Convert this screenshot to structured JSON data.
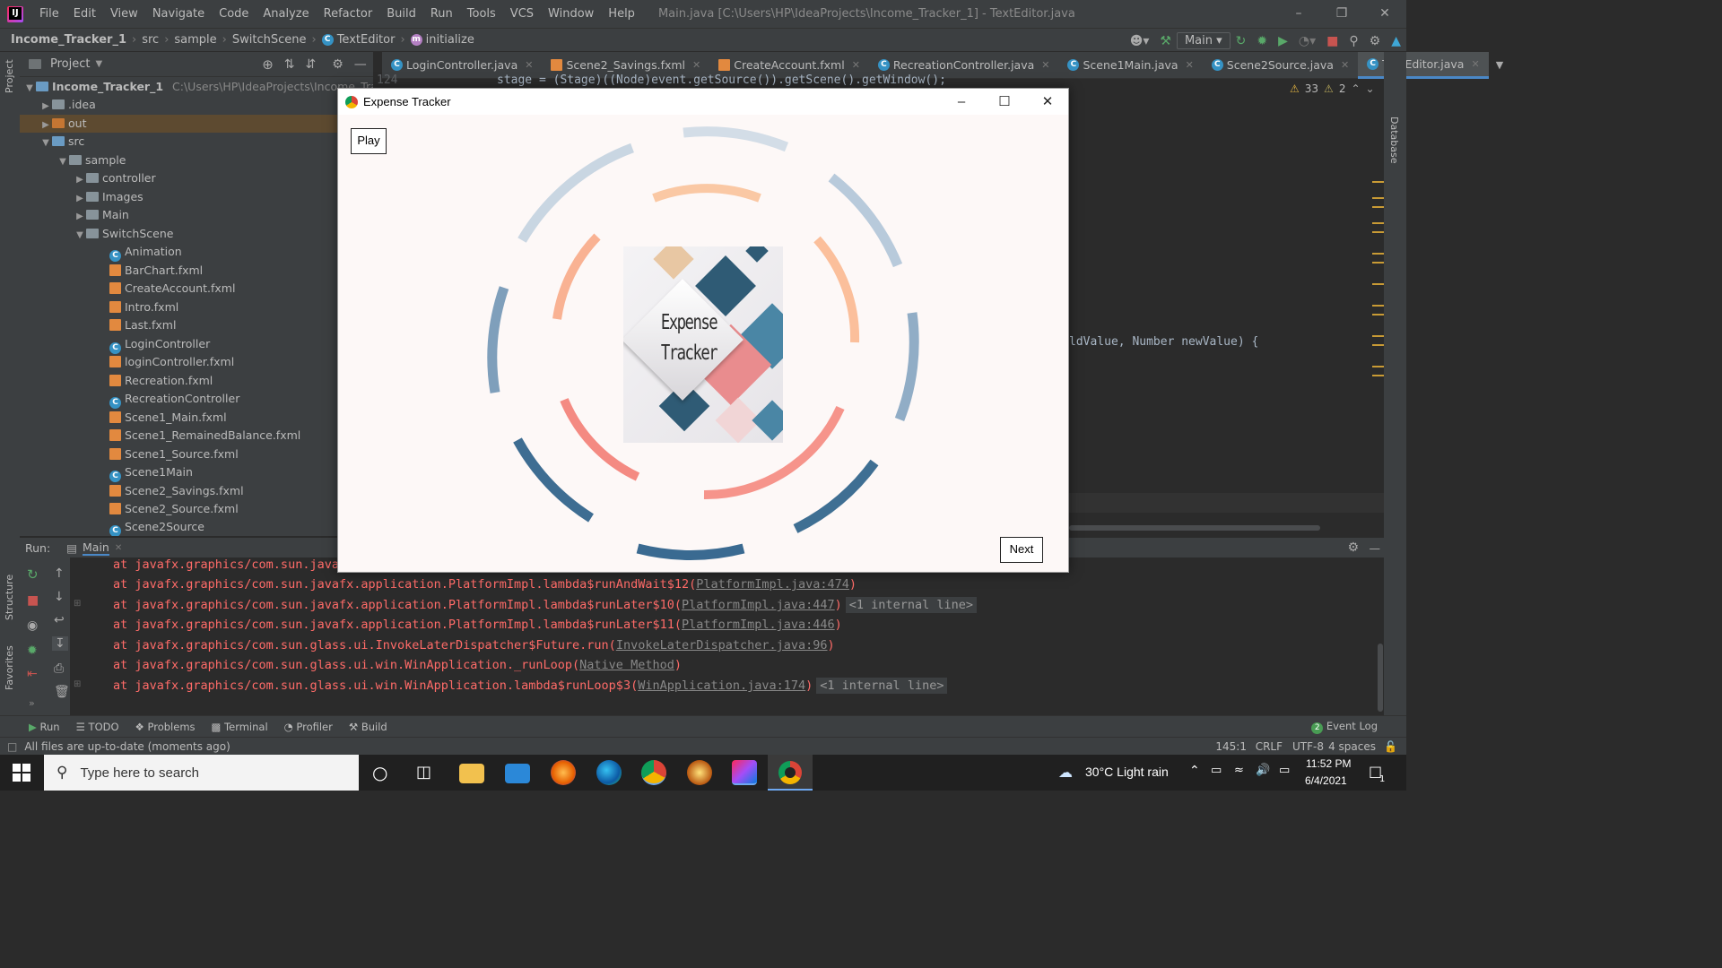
{
  "ide": {
    "menu": [
      "File",
      "Edit",
      "View",
      "Navigate",
      "Code",
      "Analyze",
      "Refactor",
      "Build",
      "Run",
      "Tools",
      "VCS",
      "Window",
      "Help"
    ],
    "window_title": "Main.java [C:\\Users\\HP\\IdeaProjects\\Income_Tracker_1] - TextEditor.java",
    "breadcrumb": {
      "project": "Income_Tracker_1",
      "src": "src",
      "sample": "sample",
      "switchscene": "SwitchScene",
      "class": "TextEditor",
      "method": "initialize"
    },
    "run_config": "Main",
    "project_panel": {
      "title": "Project",
      "root_name": "Income_Tracker_1",
      "root_path": "C:\\Users\\HP\\IdeaProjects\\Income_Tracker_1",
      "items": [
        ".idea",
        "out",
        "src",
        "sample",
        "controller",
        "Images",
        "Main",
        "SwitchScene",
        "Animation",
        "BarChart.fxml",
        "CreateAccount.fxml",
        "Intro.fxml",
        "Last.fxml",
        "LoginController",
        "loginController.fxml",
        "Recreation.fxml",
        "RecreationController",
        "Scene1_Main.fxml",
        "Scene1_RemainedBalance.fxml",
        "Scene1_Source.fxml",
        "Scene1Main",
        "Scene2_Savings.fxml",
        "Scene2_Source.fxml",
        "Scene2Source"
      ]
    },
    "tabs": [
      "LoginController.java",
      "Scene2_Savings.fxml",
      "CreateAccount.fxml",
      "RecreationController.java",
      "Scene1Main.java",
      "Scene2Source.java",
      "TextEditor.java"
    ],
    "editor": {
      "line_number": "124",
      "line_code": "stage = (Stage)((Node)event.getSource()).getScene().getWindow();",
      "partial_code": "ldValue, Number newValue) {",
      "warnings": "33",
      "weak_warnings": "2"
    },
    "run_panel": {
      "label": "Run:",
      "tab": "Main",
      "lines": [
        {
          "text": "at javafx.graphics/com.sun.java",
          "link": "",
          "fold": ""
        },
        {
          "text": "at javafx.graphics/com.sun.javafx.application.PlatformImpl.lambda$runAndWait$12(",
          "link": "PlatformImpl.java:474",
          "fold": ""
        },
        {
          "text": "at javafx.graphics/com.sun.javafx.application.PlatformImpl.lambda$runLater$10(",
          "link": "PlatformImpl.java:447",
          "fold": "<1 internal line>"
        },
        {
          "text": "at javafx.graphics/com.sun.javafx.application.PlatformImpl.lambda$runLater$11(",
          "link": "PlatformImpl.java:446",
          "fold": ""
        },
        {
          "text": "at javafx.graphics/com.sun.glass.ui.InvokeLaterDispatcher$Future.run(",
          "link": "InvokeLaterDispatcher.java:96",
          "fold": ""
        },
        {
          "text": "at javafx.graphics/com.sun.glass.ui.win.WinApplication._runLoop(",
          "link": "Native Method",
          "fold": ""
        },
        {
          "text": "at javafx.graphics/com.sun.glass.ui.win.WinApplication.lambda$runLoop$3(",
          "link": "WinApplication.java:174",
          "fold": "<1 internal line>"
        }
      ]
    },
    "tool_windows": [
      "Run",
      "TODO",
      "Problems",
      "Terminal",
      "Profiler",
      "Build"
    ],
    "event_log": "Event Log",
    "event_count": "2",
    "status": {
      "message": "All files are up-to-date (moments ago)",
      "position": "145:1",
      "line_sep": "CRLF",
      "encoding": "UTF-8",
      "indent": "4 spaces"
    },
    "side_labels": {
      "project": "Project",
      "structure": "Structure",
      "favorites": "Favorites",
      "database": "Database"
    }
  },
  "app": {
    "title": "Expense Tracker",
    "play_label": "Play",
    "next_label": "Next",
    "logo_line1": "Expense",
    "logo_line2": "Tracker"
  },
  "taskbar": {
    "search_placeholder": "Type here to search",
    "weather": "30°C  Light rain",
    "time": "11:52 PM",
    "date": "6/4/2021",
    "notification_count": "1"
  },
  "colors": {
    "ide_bg": "#2b2b2b",
    "ide_panel": "#3c3f41",
    "error_text": "#ff6b68",
    "ring_blue": "#3a6a91",
    "ring_light_blue": "#a9c0d4",
    "ring_salmon": "#f48a82",
    "ring_peach": "#f9c29d"
  }
}
